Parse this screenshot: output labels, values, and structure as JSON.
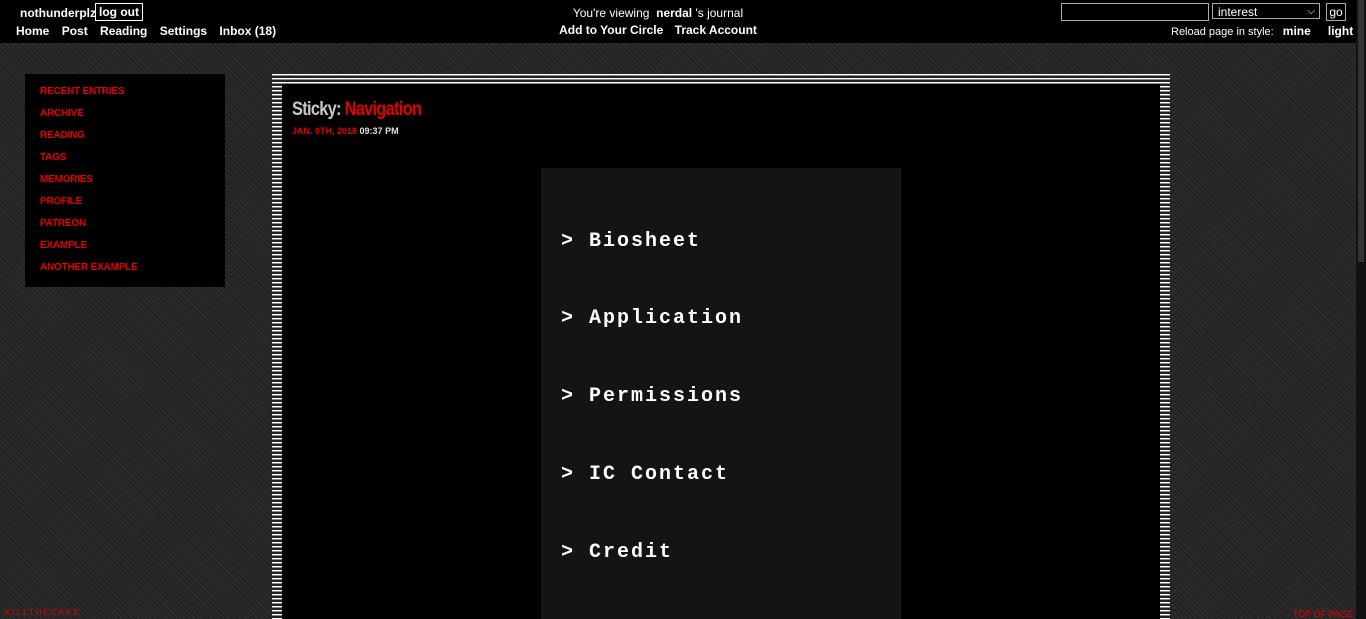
{
  "topbar": {
    "username": "nothunderplz",
    "logout": "log out",
    "nav": [
      "Home",
      "Post",
      "Reading",
      "Settings",
      "Inbox (18)"
    ],
    "viewing_prefix": "You're viewing",
    "journal_name": "nerdal",
    "journal_suffix": "'s journal",
    "add_circle": "Add to Your Circle",
    "track": "Track Account",
    "search_value": "",
    "search_select": "interest",
    "go": "go",
    "reload_label": "Reload page in style:",
    "style_mine": "mine",
    "style_light": "light"
  },
  "sidebar": {
    "items": [
      "RECENT ENTRIES",
      "ARCHIVE",
      "READING",
      "TAGS",
      "MEMORIES",
      "PROFILE",
      "PATREON",
      "EXAMPLE",
      "ANOTHER EXAMPLE"
    ]
  },
  "entry": {
    "sticky": "Sticky:",
    "title": "Navigation",
    "date": "JAN. 9TH, 2018",
    "time": "09:37 PM",
    "nav_items": [
      "> Biosheet",
      "> Application",
      "> Permissions",
      "> IC Contact",
      "> Credit"
    ]
  },
  "footer": {
    "credit": "KILLTHECAKE",
    "top": "TOP OF PAGE"
  },
  "colors": {
    "accent": "#e50000",
    "background": "#262626",
    "panel": "#000000"
  }
}
